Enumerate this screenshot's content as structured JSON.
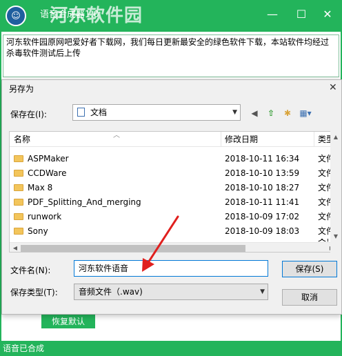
{
  "app": {
    "title": "语音合成器1.0",
    "watermark": "河东软件园",
    "logo_glyph": "☺",
    "notice_text": "河东软件园原网吧爱好者下载网，我们每日更新最安全的绿色软件下载，本站软件均经过杀毒软件测试后上传",
    "restore_button": "恢复默认",
    "status": "语音已合成",
    "controls": {
      "minimize": "—",
      "maximize": "☐",
      "close": "✕"
    },
    "accent_color": "#23b45b"
  },
  "dialog": {
    "title": "另存为",
    "close_glyph": "✕",
    "save_in_label": "保存在(I):",
    "save_in_value": "文档",
    "toolbar_icons": [
      "back-icon",
      "up-folder-icon",
      "new-folder-icon",
      "view-menu-icon"
    ],
    "toolbar_glyphs": [
      "◀",
      "⇧",
      "✱",
      "▦▾"
    ],
    "columns": {
      "name": "名称",
      "date": "修改日期",
      "type": "类型"
    },
    "files": [
      {
        "name": "ASPMaker",
        "date": "2018-10-11 16:34",
        "type": "文件"
      },
      {
        "name": "CCDWare",
        "date": "2018-10-10 13:59",
        "type": "文件"
      },
      {
        "name": "Max 8",
        "date": "2018-10-10 18:27",
        "type": "文件"
      },
      {
        "name": "PDF_Splitting_And_merging",
        "date": "2018-10-11 11:41",
        "type": "文件"
      },
      {
        "name": "runwork",
        "date": "2018-10-09 17:02",
        "type": "文件"
      },
      {
        "name": "Sony",
        "date": "2018-10-09 18:03",
        "type": "文件"
      },
      {
        "name": "",
        "date": "",
        "type": "文件"
      }
    ],
    "filename_label": "文件名(N):",
    "filename_value": "河东软件语音",
    "filetype_label": "保存类型(T):",
    "filetype_value": "音频文件（.wav)",
    "save_button": "保存(S)",
    "cancel_button": "取消",
    "annotation_arrow_color": "#e0201e"
  }
}
